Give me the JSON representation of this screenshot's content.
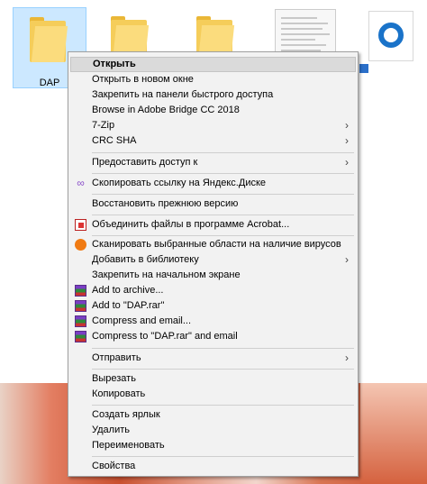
{
  "desktop": {
    "icons": [
      {
        "label": "DAP",
        "type": "folder",
        "selected": true
      },
      {
        "label": "",
        "type": "folder"
      },
      {
        "label": "",
        "type": "folder"
      },
      {
        "label": "",
        "type": "document-thumbnail"
      },
      {
        "label": "",
        "type": "edge-shortcut"
      }
    ]
  },
  "menu": {
    "items": [
      {
        "label": "Открыть",
        "bold": true,
        "hover": true
      },
      {
        "label": "Открыть в новом окне"
      },
      {
        "label": "Закрепить на панели быстрого доступа"
      },
      {
        "label": "Browse in Adobe Bridge CC 2018"
      },
      {
        "label": "7-Zip",
        "submenu": true
      },
      {
        "label": "CRC SHA",
        "submenu": true
      },
      {
        "label": "Предоставить доступ к",
        "submenu": true
      },
      {
        "label": "Скопировать ссылку на Яндекс.Диске",
        "icon": "yandex-link-icon"
      },
      {
        "label": "Восстановить прежнюю версию"
      },
      {
        "label": "Объединить файлы в программе Acrobat...",
        "icon": "acrobat-icon"
      },
      {
        "label": "Сканировать выбранные области на наличие вирусов",
        "icon": "avast-icon"
      },
      {
        "label": "Добавить в библиотеку",
        "submenu": true
      },
      {
        "label": "Закрепить на начальном экране"
      },
      {
        "label": "Add to archive...",
        "icon": "winrar-icon"
      },
      {
        "label": "Add to \"DAP.rar\"",
        "icon": "winrar-icon"
      },
      {
        "label": "Compress and email...",
        "icon": "winrar-icon"
      },
      {
        "label": "Compress to \"DAP.rar\" and email",
        "icon": "winrar-icon"
      },
      {
        "label": "Отправить",
        "submenu": true
      },
      {
        "label": "Вырезать"
      },
      {
        "label": "Копировать"
      },
      {
        "label": "Создать ярлык"
      },
      {
        "label": "Удалить"
      },
      {
        "label": "Переименовать"
      },
      {
        "label": "Свойства"
      }
    ],
    "submenu_arrow": "›"
  }
}
